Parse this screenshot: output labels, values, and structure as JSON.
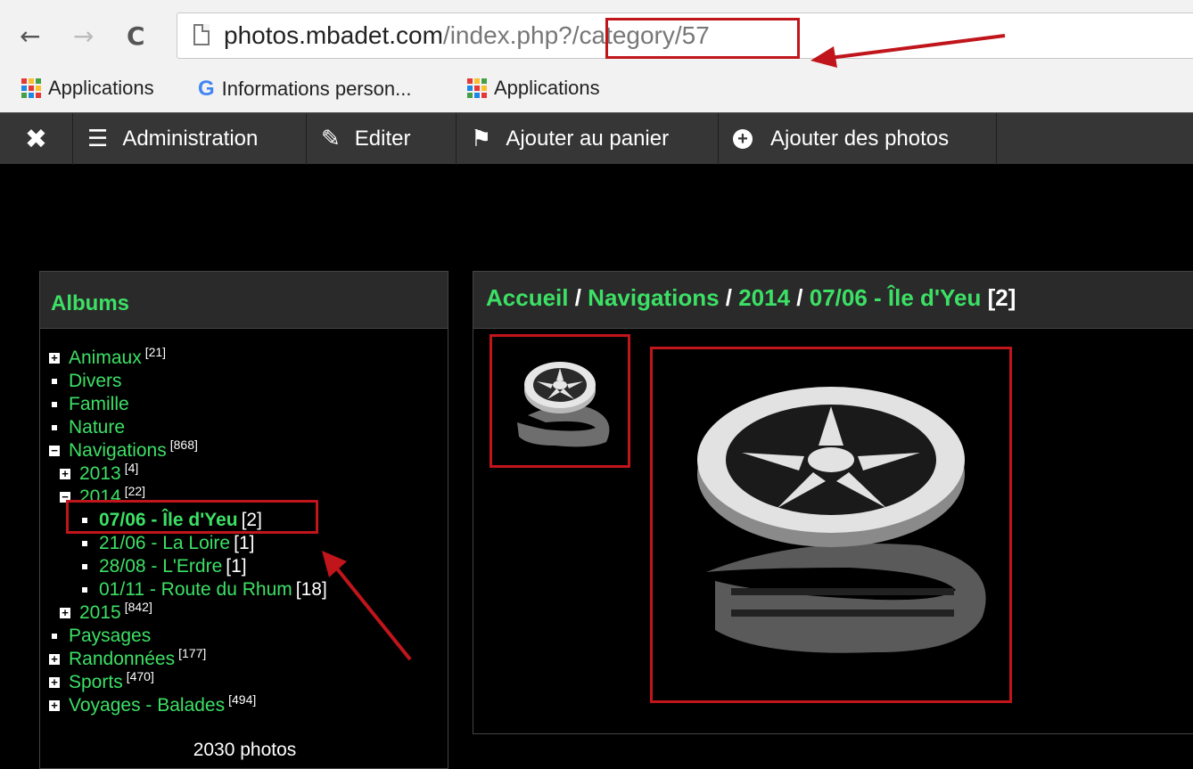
{
  "browser": {
    "url_host": "photos.mbadet.com",
    "url_path": "/index.php",
    "url_query": "?/category/57",
    "bookmarks": [
      {
        "label": "Applications",
        "icon": "apps-grid-icon"
      },
      {
        "label": "Informations person...",
        "icon": "google-icon"
      },
      {
        "label": "Applications",
        "icon": "apps-grid-icon"
      }
    ]
  },
  "toolbar": {
    "close_icon": "✖",
    "items": [
      {
        "label": "Administration",
        "icon": "menu-icon"
      },
      {
        "label": "Editer",
        "icon": "pencil-icon"
      },
      {
        "label": "Ajouter au panier",
        "icon": "flag-icon"
      },
      {
        "label": "Ajouter des photos",
        "icon": "plus-circle-icon"
      }
    ]
  },
  "albums": {
    "title": "Albums",
    "items": [
      {
        "label": "Animaux",
        "count": "[21]"
      },
      {
        "label": "Divers"
      },
      {
        "label": "Famille"
      },
      {
        "label": "Nature"
      },
      {
        "label": "Navigations",
        "count": "[868]"
      },
      {
        "label": "2013",
        "count": "[4]"
      },
      {
        "label": "2014",
        "count": "[22]"
      },
      {
        "label": "07/06 - Île d'Yeu",
        "count": "[2]"
      },
      {
        "label": "21/06 - La Loire",
        "count": "[1]"
      },
      {
        "label": "28/08 - L'Erdre",
        "count": "[1]"
      },
      {
        "label": "01/11 - Route du Rhum",
        "count": "[18]"
      },
      {
        "label": "2015",
        "count": "[842]"
      },
      {
        "label": "Paysages"
      },
      {
        "label": "Randonnées",
        "count": "[177]"
      },
      {
        "label": "Sports",
        "count": "[470]"
      },
      {
        "label": "Voyages - Balades",
        "count": "[494]"
      }
    ],
    "photo_count": "2030 photos"
  },
  "breadcrumb": {
    "home": "Accueil",
    "sep": " / ",
    "level1": "Navigations",
    "level2": "2014",
    "current": "07/06 - Île d'Yeu",
    "count": "[2]"
  },
  "colors": {
    "accent_green": "#3ce065",
    "annotation_red": "#c0151b",
    "toolbar_bg": "#363636"
  }
}
